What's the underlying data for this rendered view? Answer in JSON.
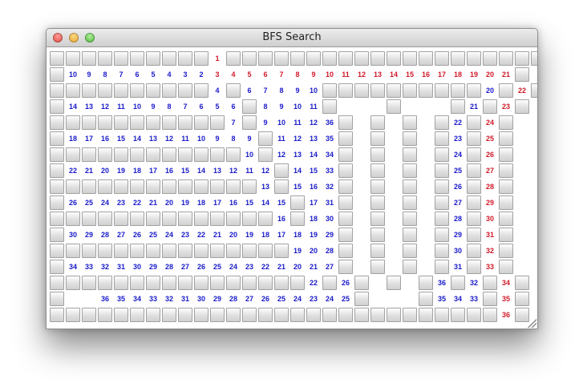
{
  "window": {
    "title": "BFS Search",
    "controls": [
      "close-button",
      "minimize-button",
      "zoom-button"
    ]
  },
  "colors": {
    "path": "#1a1acb",
    "highlight": "#d11a2a",
    "wall": "#d8d8d8"
  },
  "grid_legend": {
    "#": "wall",
    ".": "empty",
    "number": "BFS distance"
  },
  "grid": [
    [
      "#",
      "#",
      "#",
      "#",
      "#",
      "#",
      "#",
      "#",
      "#",
      "#",
      {
        "v": "1",
        "r": true
      },
      "#",
      "#",
      "#",
      "#",
      "#",
      "#",
      "#",
      "#",
      "#",
      "#",
      "#",
      "#",
      "#",
      "#",
      "#",
      "#",
      "#",
      "#",
      "#",
      "#",
      "#"
    ],
    [
      "#",
      "10",
      "9",
      "8",
      "7",
      "6",
      "5",
      "4",
      "3",
      "2",
      {
        "v": "3",
        "r": true
      },
      {
        "v": "4",
        "r": true
      },
      {
        "v": "5",
        "r": true
      },
      {
        "v": "6",
        "r": true
      },
      {
        "v": "7",
        "r": true
      },
      {
        "v": "8",
        "r": true
      },
      {
        "v": "9",
        "r": true
      },
      {
        "v": "10",
        "r": true
      },
      {
        "v": "11",
        "r": true
      },
      {
        "v": "12",
        "r": true
      },
      {
        "v": "13",
        "r": true
      },
      {
        "v": "14",
        "r": true
      },
      {
        "v": "15",
        "r": true
      },
      {
        "v": "16",
        "r": true
      },
      {
        "v": "17",
        "r": true
      },
      {
        "v": "18",
        "r": true
      },
      {
        "v": "19",
        "r": true
      },
      {
        "v": "20",
        "r": true
      },
      {
        "v": "21",
        "r": true
      },
      "#"
    ],
    [
      "#",
      "#",
      "#",
      "#",
      "#",
      "#",
      "#",
      "#",
      "#",
      "#",
      "4",
      "#",
      "6",
      "7",
      "8",
      "9",
      "10",
      "#",
      "#",
      "#",
      "#",
      "#",
      "#",
      "#",
      "#",
      "#",
      "#",
      "20",
      "#",
      {
        "v": "22",
        "r": true
      },
      "#"
    ],
    [
      "#",
      "14",
      "13",
      "12",
      "11",
      "10",
      "9",
      "8",
      "7",
      "6",
      "5",
      "6",
      "#",
      "8",
      "9",
      "10",
      "11",
      "#",
      ".",
      ".",
      ".",
      "#",
      ".",
      ".",
      ".",
      "#",
      "21",
      "#",
      {
        "v": "23",
        "r": true
      },
      "#"
    ],
    [
      "#",
      "#",
      "#",
      "#",
      "#",
      "#",
      "#",
      "#",
      "#",
      "#",
      "#",
      "7",
      "#",
      "9",
      "10",
      "11",
      "12",
      "36",
      "#",
      ".",
      "#",
      ".",
      "#",
      ".",
      "#",
      "22",
      "#",
      {
        "v": "24",
        "r": true
      },
      "#"
    ],
    [
      "#",
      "18",
      "17",
      "16",
      "15",
      "14",
      "13",
      "12",
      "11",
      "10",
      "9",
      "8",
      "9",
      "#",
      "11",
      "12",
      "13",
      "35",
      "#",
      ".",
      "#",
      ".",
      "#",
      ".",
      "#",
      "23",
      "#",
      {
        "v": "25",
        "r": true
      },
      "#"
    ],
    [
      "#",
      "#",
      "#",
      "#",
      "#",
      "#",
      "#",
      "#",
      "#",
      "#",
      "#",
      "#",
      "10",
      "#",
      "12",
      "13",
      "14",
      "34",
      "#",
      ".",
      "#",
      ".",
      "#",
      ".",
      "#",
      "24",
      "#",
      {
        "v": "26",
        "r": true
      },
      "#"
    ],
    [
      "#",
      "22",
      "21",
      "20",
      "19",
      "18",
      "17",
      "16",
      "15",
      "14",
      "13",
      "12",
      "11",
      "12",
      "#",
      "14",
      "15",
      "33",
      "#",
      ".",
      "#",
      ".",
      "#",
      ".",
      "#",
      "25",
      "#",
      {
        "v": "27",
        "r": true
      },
      "#"
    ],
    [
      "#",
      "#",
      "#",
      "#",
      "#",
      "#",
      "#",
      "#",
      "#",
      "#",
      "#",
      "#",
      "#",
      "13",
      "#",
      "15",
      "16",
      "32",
      "#",
      ".",
      "#",
      ".",
      "#",
      ".",
      "#",
      "26",
      "#",
      {
        "v": "28",
        "r": true
      },
      "#"
    ],
    [
      "#",
      "26",
      "25",
      "24",
      "23",
      "22",
      "21",
      "20",
      "19",
      "18",
      "17",
      "16",
      "15",
      "14",
      "15",
      "#",
      "17",
      "31",
      "#",
      ".",
      "#",
      ".",
      "#",
      ".",
      "#",
      "27",
      "#",
      {
        "v": "29",
        "r": true
      },
      "#"
    ],
    [
      "#",
      "#",
      "#",
      "#",
      "#",
      "#",
      "#",
      "#",
      "#",
      "#",
      "#",
      "#",
      "#",
      "#",
      "16",
      "#",
      "18",
      "30",
      "#",
      ".",
      "#",
      ".",
      "#",
      ".",
      "#",
      "28",
      "#",
      {
        "v": "30",
        "r": true
      },
      "#"
    ],
    [
      "#",
      "30",
      "29",
      "28",
      "27",
      "26",
      "25",
      "24",
      "23",
      "22",
      "21",
      "20",
      "19",
      "18",
      "17",
      "18",
      "19",
      "29",
      "#",
      ".",
      "#",
      ".",
      "#",
      ".",
      "#",
      "29",
      "#",
      {
        "v": "31",
        "r": true
      },
      "#"
    ],
    [
      "#",
      "#",
      "#",
      "#",
      "#",
      "#",
      "#",
      "#",
      "#",
      "#",
      "#",
      "#",
      "#",
      "#",
      "#",
      "19",
      "20",
      "28",
      "#",
      ".",
      "#",
      ".",
      "#",
      ".",
      "#",
      "30",
      "#",
      {
        "v": "32",
        "r": true
      },
      "#"
    ],
    [
      "#",
      "34",
      "33",
      "32",
      "31",
      "30",
      "29",
      "28",
      "27",
      "26",
      "25",
      "24",
      "23",
      "22",
      "21",
      "20",
      "21",
      "27",
      "#",
      ".",
      "#",
      ".",
      "#",
      ".",
      "#",
      "31",
      "#",
      {
        "v": "33",
        "r": true
      },
      "#"
    ],
    [
      "#",
      "#",
      "#",
      "#",
      "#",
      "#",
      "#",
      "#",
      "#",
      "#",
      "#",
      "#",
      "#",
      "#",
      "#",
      "#",
      "22",
      "#",
      "26",
      "#",
      ".",
      "#",
      ".",
      "#",
      "36",
      "#",
      "32",
      "#",
      {
        "v": "34",
        "r": true
      },
      "#"
    ],
    [
      "#",
      ".",
      ".",
      "36",
      "35",
      "34",
      "33",
      "32",
      "31",
      "30",
      "29",
      "28",
      "27",
      "26",
      "25",
      "24",
      "23",
      "24",
      "25",
      "#",
      ".",
      ".",
      ".",
      "#",
      "35",
      "34",
      "33",
      "#",
      {
        "v": "35",
        "r": true
      },
      "#"
    ],
    [
      "#",
      "#",
      "#",
      "#",
      "#",
      "#",
      "#",
      "#",
      "#",
      "#",
      "#",
      "#",
      "#",
      "#",
      "#",
      "#",
      "#",
      "#",
      "#",
      "#",
      "#",
      "#",
      "#",
      "#",
      "#",
      "#",
      "#",
      "#",
      {
        "v": "36",
        "r": true
      },
      "#"
    ]
  ]
}
